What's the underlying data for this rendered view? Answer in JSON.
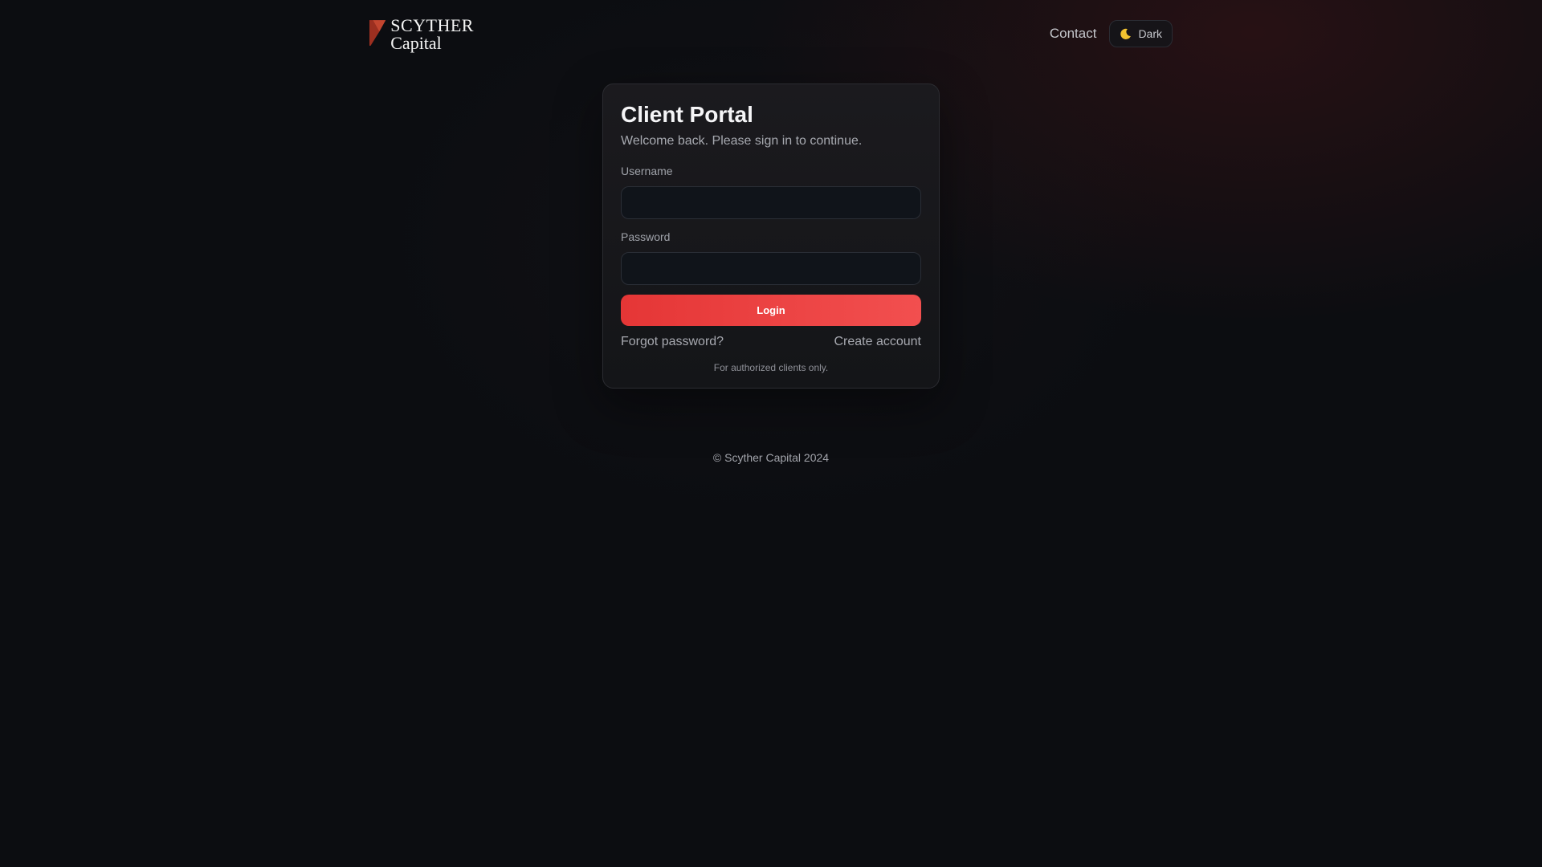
{
  "brand": {
    "name_line1": "SCYTHER",
    "name_line2": "Capital",
    "accent": "#c0392b"
  },
  "nav": {
    "contact_label": "Contact",
    "theme_toggle_label": "Dark",
    "theme_icon": "moon-icon"
  },
  "login_card": {
    "title": "Client Portal",
    "subtitle": "Welcome back. Please sign in to continue.",
    "username_label": "Username",
    "username_value": "",
    "password_label": "Password",
    "password_value": "",
    "login_button_label": "Login",
    "forgot_password_link": "Forgot password?",
    "create_account_link": "Create account",
    "notice": "For authorized clients only.",
    "button_color": "#e53e3e"
  },
  "footer": {
    "copyright": "© Scyther Capital 2024"
  }
}
